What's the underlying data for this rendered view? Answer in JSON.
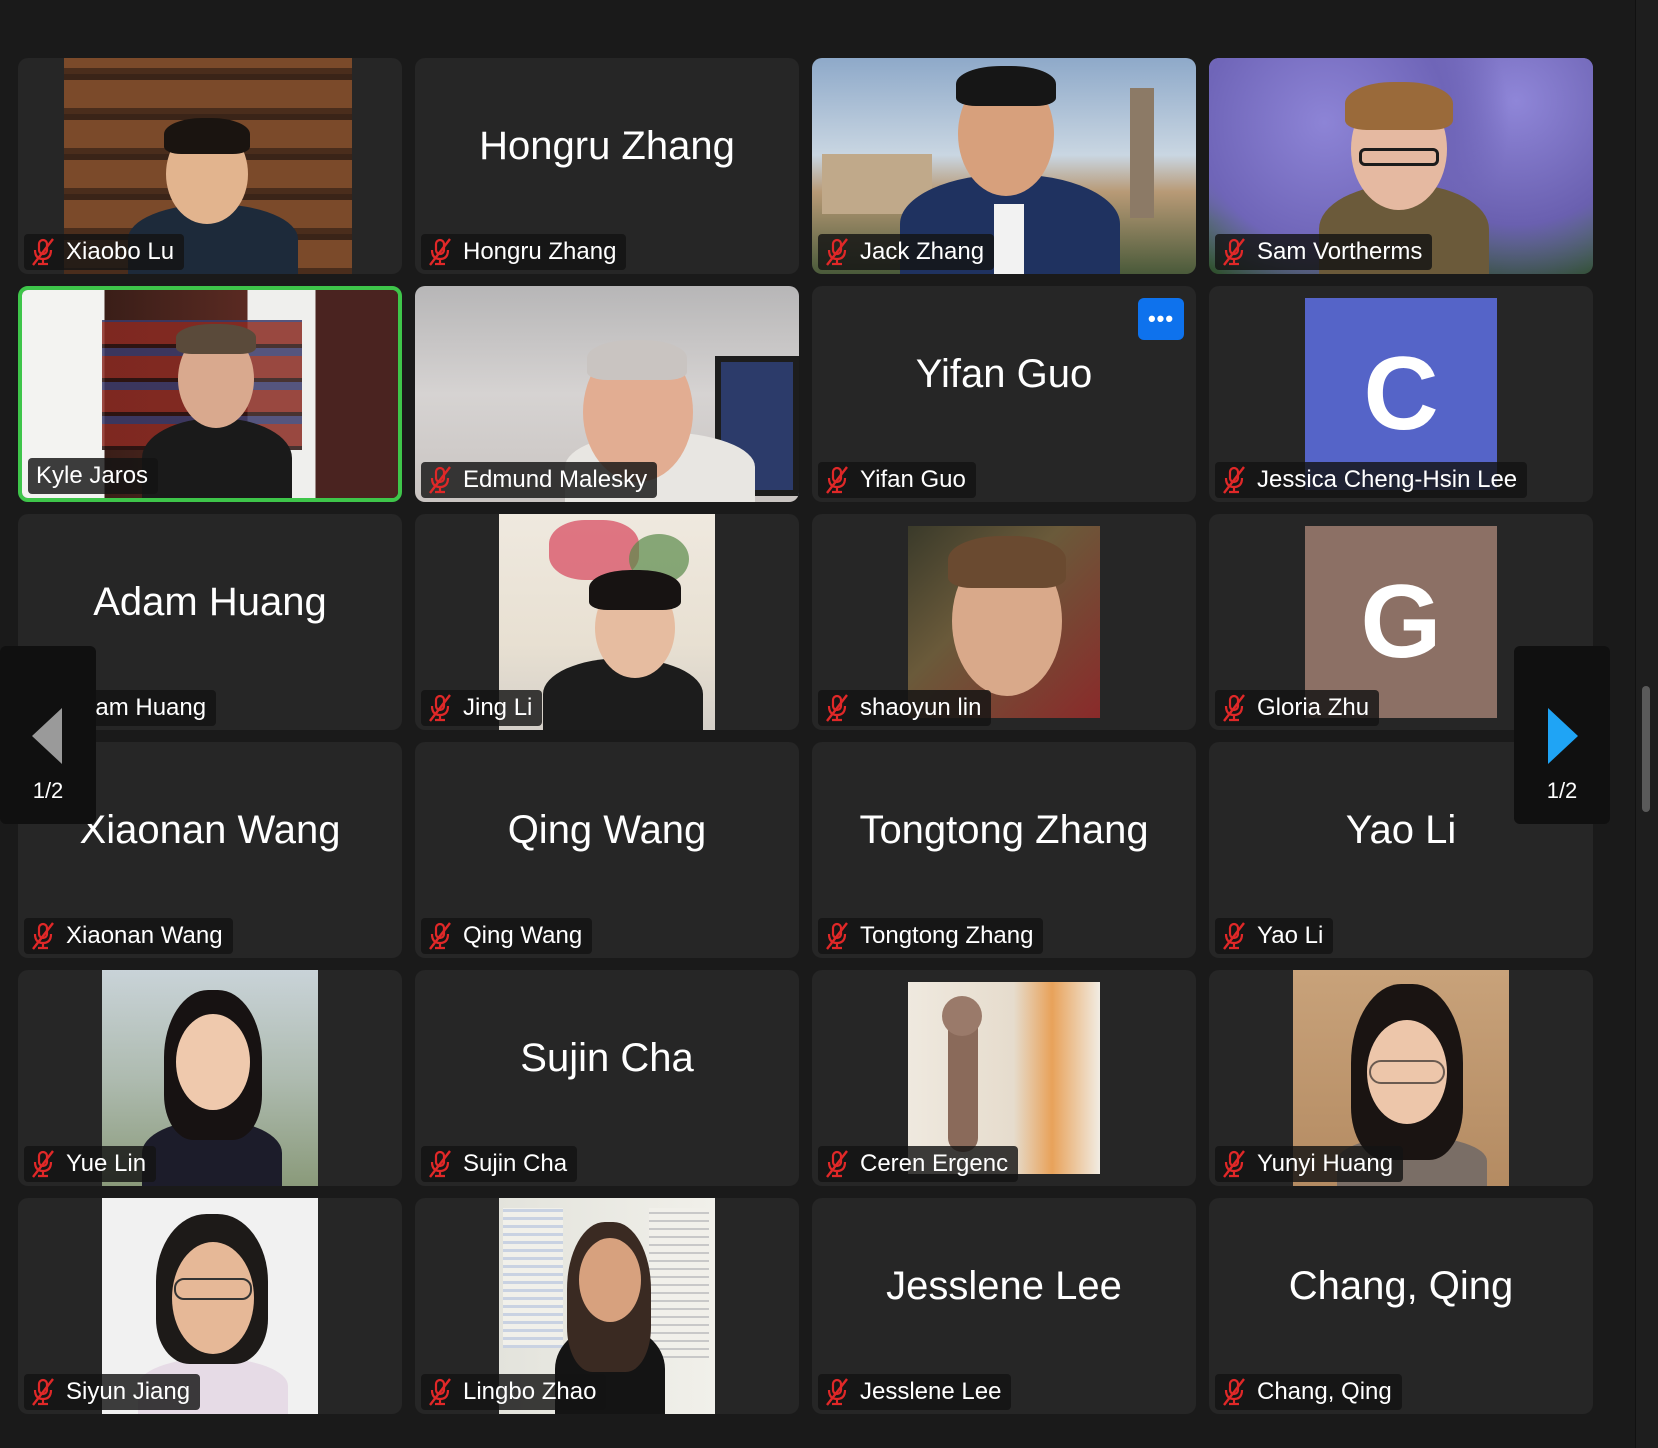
{
  "colors": {
    "accent": "#0e72ed",
    "active_border": "#3ec54a",
    "muted_mic": "#e02828"
  },
  "pagination": {
    "prev_label": "1/2",
    "next_label": "1/2"
  },
  "participants": [
    {
      "label": "Xiaobo Lu"
    },
    {
      "label": "Hongru Zhang",
      "big": "Hongru Zhang"
    },
    {
      "label": "Jack Zhang"
    },
    {
      "label": "Sam Vortherms"
    },
    {
      "label": "Kyle Jaros"
    },
    {
      "label": "Edmund Malesky"
    },
    {
      "label": "Yifan Guo",
      "big": "Yifan Guo",
      "more": "•••"
    },
    {
      "label": "Jessica Cheng-Hsin Lee",
      "avatar": "C"
    },
    {
      "label": "Adam Huang",
      "big": "Adam Huang"
    },
    {
      "label": "Jing Li"
    },
    {
      "label": "shaoyun lin"
    },
    {
      "label": "Gloria Zhu",
      "avatar": "G"
    },
    {
      "label": "Xiaonan Wang",
      "big": "Xiaonan Wang"
    },
    {
      "label": "Qing Wang",
      "big": "Qing Wang"
    },
    {
      "label": "Tongtong Zhang",
      "big": "Tongtong Zhang"
    },
    {
      "label": "Yao Li",
      "big": "Yao Li"
    },
    {
      "label": "Yue Lin"
    },
    {
      "label": "Sujin Cha",
      "big": "Sujin Cha"
    },
    {
      "label": "Ceren Ergenc"
    },
    {
      "label": "Yunyi Huang"
    },
    {
      "label": "Siyun Jiang"
    },
    {
      "label": "Lingbo Zhao"
    },
    {
      "label": "Jesslene Lee",
      "big": "Jesslene Lee"
    },
    {
      "label": "Chang, Qing",
      "big": "Chang, Qing"
    }
  ]
}
